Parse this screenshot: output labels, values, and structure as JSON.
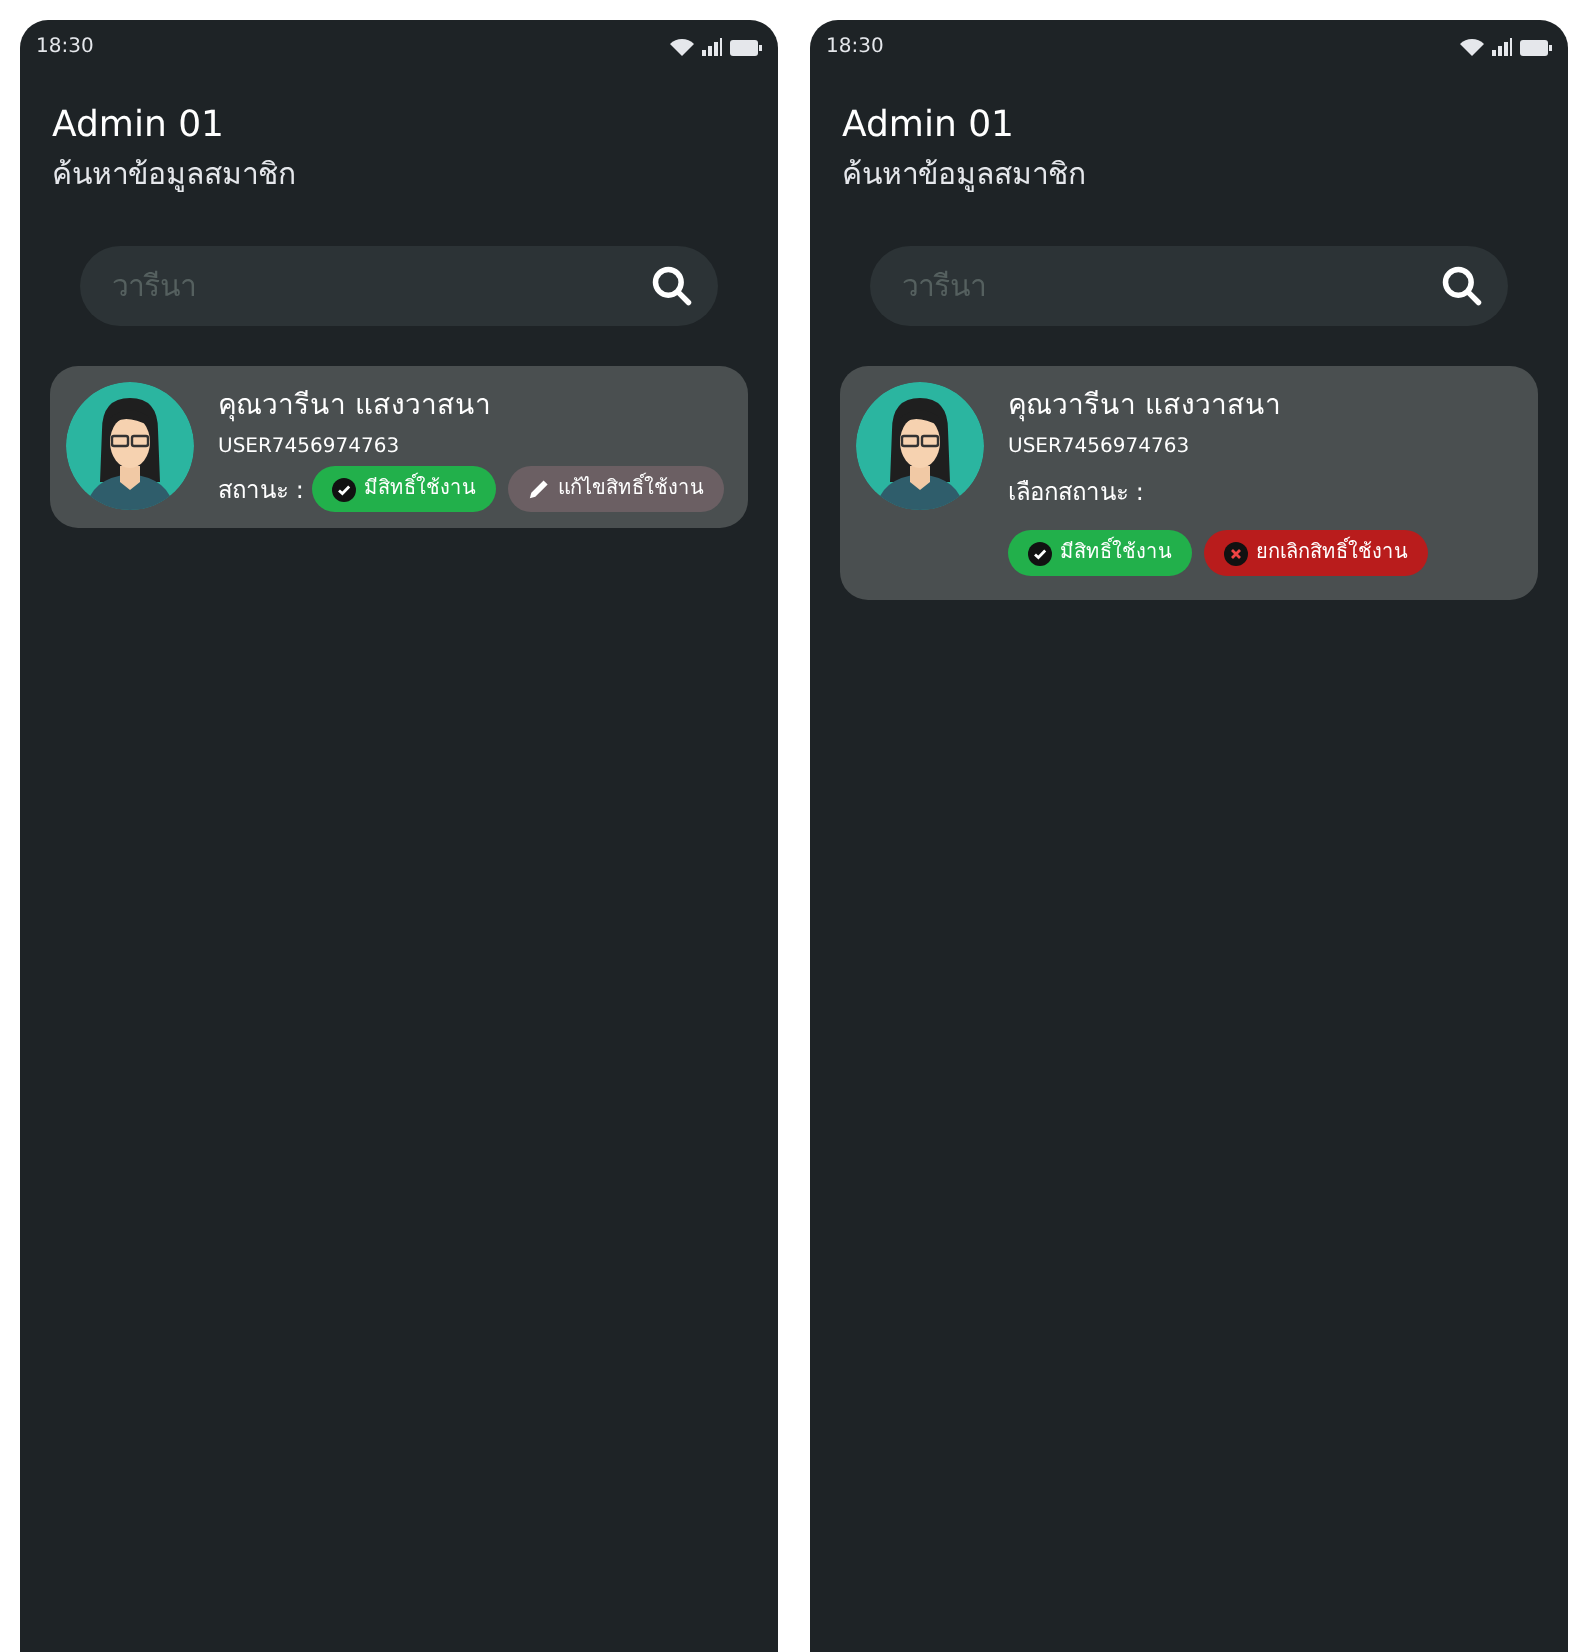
{
  "screens": [
    {
      "status_bar": {
        "time": "18:30"
      },
      "header": {
        "title": "Admin 01",
        "subtitle": "ค้นหาข้อมูลสมาชิก"
      },
      "search": {
        "placeholder": "วารีนา"
      },
      "member": {
        "name": "คุณวารีนา แสงวาสนา",
        "user_id": "USER7456974763",
        "status_label": "สถานะ :",
        "buttons_on_own_line": false,
        "buttons": [
          {
            "kind": "approved",
            "label": "มีสิทธิ์ใช้งาน"
          },
          {
            "kind": "edit",
            "label": "แก้ไขสิทธิ์ใช้งาน"
          }
        ]
      }
    },
    {
      "status_bar": {
        "time": "18:30"
      },
      "header": {
        "title": "Admin 01",
        "subtitle": "ค้นหาข้อมูลสมาชิก"
      },
      "search": {
        "placeholder": "วารีนา"
      },
      "member": {
        "name": "คุณวารีนา แสงวาสนา",
        "user_id": "USER7456974763",
        "status_label": "เลือกสถานะ :",
        "buttons_on_own_line": true,
        "buttons": [
          {
            "kind": "approved",
            "label": "มีสิทธิ์ใช้งาน"
          },
          {
            "kind": "revoke",
            "label": "ยกเลิกสิทธิ์ใช้งาน"
          }
        ]
      }
    }
  ]
}
